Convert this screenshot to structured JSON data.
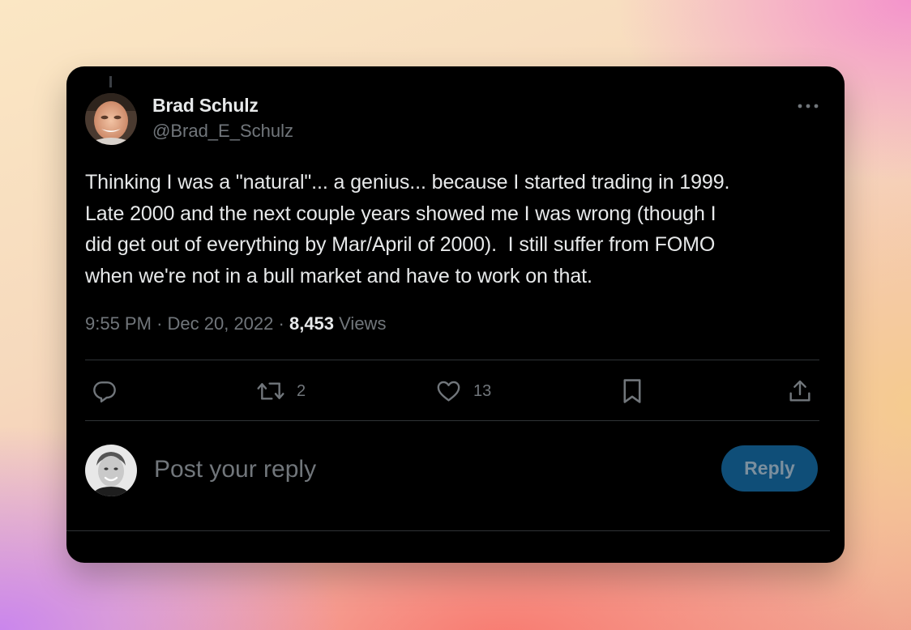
{
  "tweet": {
    "author": {
      "name": "Brad Schulz",
      "handle": "@Brad_E_Schulz",
      "avatar_icon": "author-avatar-photo"
    },
    "more_icon": "more-options-icon",
    "text": "Thinking I was a \"natural\"... a genius... because I started trading in 1999.\nLate 2000 and the next couple years showed me I was wrong (though I\ndid get out of everything by Mar/April of 2000).  I still suffer from FOMO\nwhen we're not in a bull market and have to work on that.",
    "time": "9:55 PM",
    "separator": "·",
    "date": "Dec 20, 2022",
    "views_count": "8,453",
    "views_label": "Views"
  },
  "actions": {
    "reply": {
      "icon": "reply-bubble-icon",
      "count": ""
    },
    "retweet": {
      "icon": "retweet-icon",
      "count": "2"
    },
    "like": {
      "icon": "heart-icon",
      "count": "13"
    },
    "bookmark": {
      "icon": "bookmark-icon",
      "count": ""
    },
    "share": {
      "icon": "share-icon",
      "count": ""
    }
  },
  "composer": {
    "avatar_icon": "current-user-avatar-photo",
    "placeholder": "Post your reply",
    "value": "",
    "button_label": "Reply"
  },
  "colors": {
    "card_background": "#000000",
    "primary_text": "#e7e9ea",
    "secondary_text": "#71767b",
    "divider": "#2f3336",
    "reply_button_disabled": "#0f4e78"
  }
}
